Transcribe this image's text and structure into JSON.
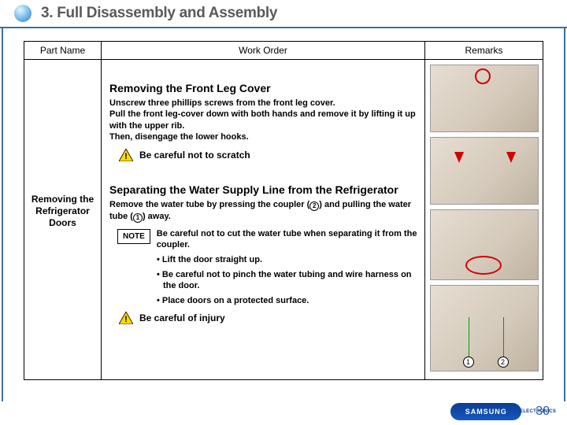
{
  "header": {
    "section_number": "3.",
    "title": "Full Disassembly and Assembly"
  },
  "table": {
    "headers": {
      "part_name": "Part Name",
      "work_order": "Work Order",
      "remarks": "Remarks"
    },
    "part_name": "Removing the\nRefrigerator\nDoors",
    "step1": {
      "title": "Removing the Front Leg Cover",
      "body": "Unscrew three phillips screws from the front leg cover.\nPull the front leg-cover down with both hands and remove it by lifting it up with the upper rib.\nThen, disengage the lower hooks.",
      "warning": "Be careful not to scratch"
    },
    "step2": {
      "title": "Separating the Water Supply Line from the Refrigerator",
      "body_pre": "Remove the water tube by pressing the coupler (",
      "body_mid": ") and pulling the water tube (",
      "body_post": ") away.",
      "ref2": "2",
      "ref1": "1",
      "note_label": "NOTE",
      "note_body": "Be careful not to cut the water tube when separating it from the coupler.",
      "bullets": [
        "• Lift the door straight up.",
        "• Be careful not to pinch the water tubing and wire harness on the door.",
        "• Place doors on a protected surface."
      ],
      "warning": "Be careful of injury"
    },
    "callouts": {
      "n1": "1",
      "n2": "2"
    }
  },
  "footer": {
    "brand": "SAMSUNG",
    "brand_sub": "ELECTRONICS",
    "page": "30"
  }
}
